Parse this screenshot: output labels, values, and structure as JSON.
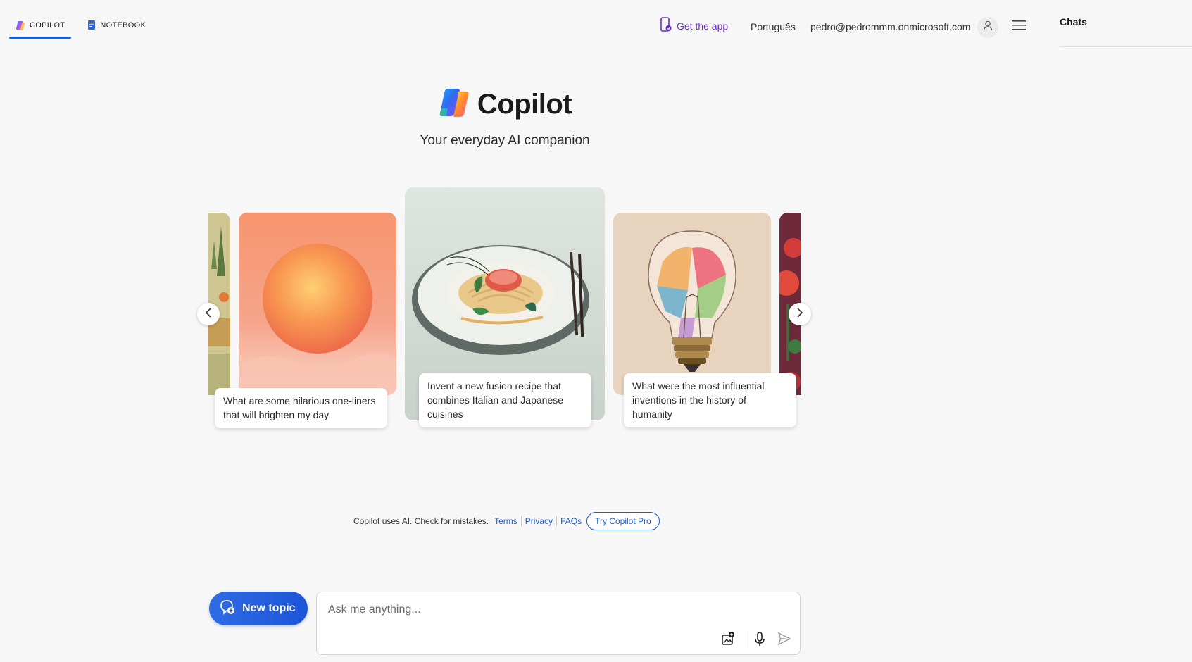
{
  "nav": {
    "tabs": [
      {
        "label": "COPILOT",
        "active": true
      },
      {
        "label": "NOTEBOOK",
        "active": false
      }
    ],
    "get_app": "Get the app",
    "language": "Português",
    "account_email": "pedro@pedrommm.onmicrosoft.com"
  },
  "sidebar": {
    "title": "Chats"
  },
  "hero": {
    "title": "Copilot",
    "subtitle": "Your everyday AI companion"
  },
  "carousel": {
    "cards": [
      {
        "caption": "What are some hilarious one-liners that will brighten my day",
        "image": "orange-sun"
      },
      {
        "caption": "Invent a new fusion recipe that combines Italian and Japanese cuisines",
        "image": "fusion-dish"
      },
      {
        "caption": "What were the most influential inventions in the history of humanity",
        "image": "colorful-lightbulb"
      }
    ]
  },
  "footer": {
    "disclaimer": "Copilot uses AI. Check for mistakes.",
    "links": [
      "Terms",
      "Privacy",
      "FAQs"
    ],
    "pro_button": "Try Copilot Pro"
  },
  "composer": {
    "new_topic": "New topic",
    "placeholder": "Ask me anything..."
  },
  "colors": {
    "accent": "#1a5bd8",
    "get_app": "#6b2ec7",
    "background": "#f7f7f7"
  }
}
